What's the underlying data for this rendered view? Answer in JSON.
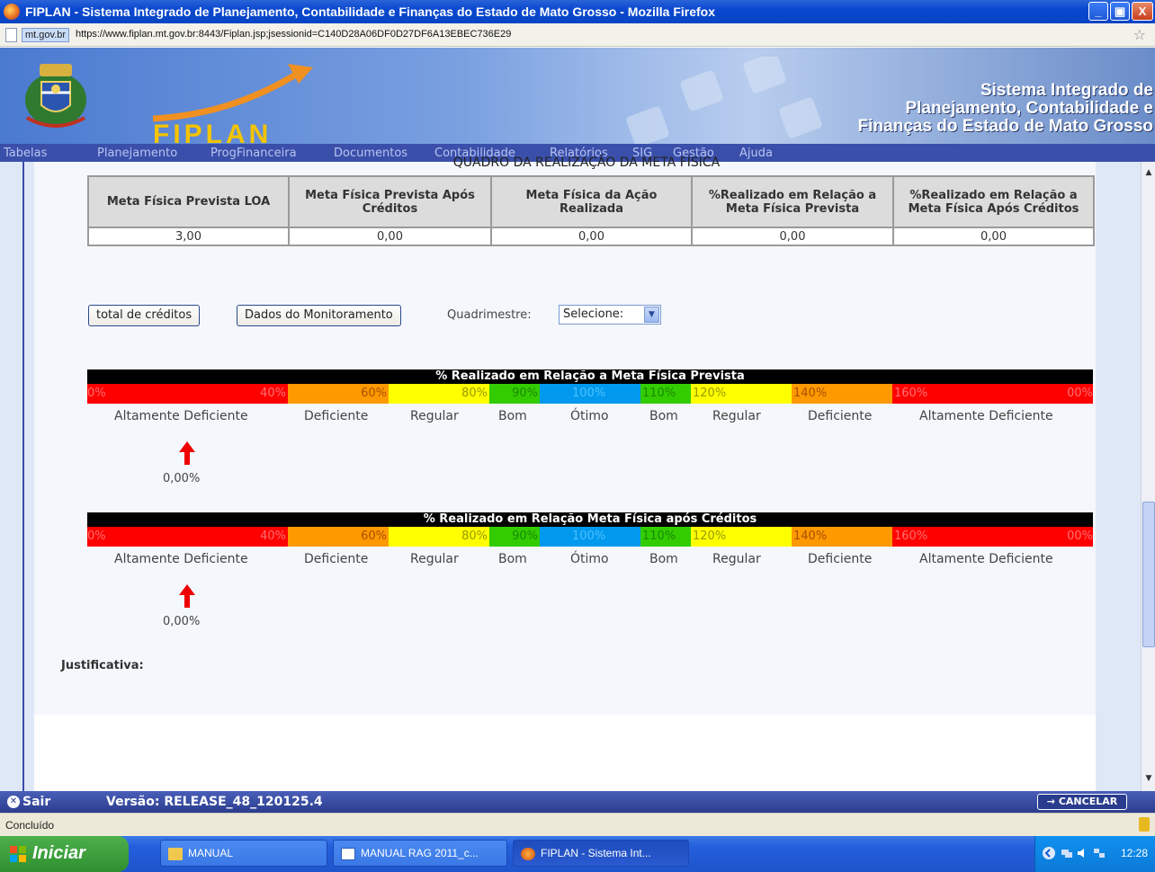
{
  "window": {
    "title": "FIPLAN - Sistema Integrado de Planejamento, Contabilidade e Finanças do Estado de Mato Grosso - Mozilla Firefox",
    "minimize": "_",
    "maximize": "▣",
    "close": "X"
  },
  "addressbar": {
    "domain": "mt.gov.br",
    "url": "https://www.fiplan.mt.gov.br:8443/Fiplan.jsp;jsessionid=C140D28A06DF0D27DF6A13EBEC736E29"
  },
  "banner": {
    "logo": "FIPLAN",
    "title_line1": "Sistema Integrado de",
    "title_line2": "Planejamento, Contabilidade e",
    "title_line3": "Finanças do Estado de Mato Grosso"
  },
  "menu": [
    "Tabelas",
    "Planejamento",
    "ProgFinanceira",
    "Documentos",
    "Contabilidade",
    "Relatórios",
    "SIG",
    "Gestão",
    "Ajuda"
  ],
  "quadro": {
    "title": "QUADRO DA REALIZAÇÃO DA META FÍSICA",
    "headers": [
      "Meta Física Prevista LOA",
      "Meta Física Prevista Após Créditos",
      "Meta Física da Ação Realizada",
      "%Realizado em Relação a Meta Física Prevista",
      "%Realizado em Relação a Meta Física Após Créditos"
    ],
    "values": [
      "3,00",
      "0,00",
      "0,00",
      "0,00",
      "0,00"
    ]
  },
  "buttons": {
    "total_creditos": "total de créditos",
    "dados_monitoramento": "Dados do Monitoramento"
  },
  "quadrimestre": {
    "label": "Quadrimestre:",
    "selected": "Selecione:"
  },
  "scale_colors": {
    "red": "#ff0000",
    "orange": "#ff9900",
    "yellow": "#ffff00",
    "green": "#33cc00",
    "blue": "#0099ee"
  },
  "scale_labels": [
    "0%",
    "40%",
    "60%",
    "80%",
    "90%",
    "100%",
    "110%",
    "120%",
    "140%",
    "160%",
    "00%"
  ],
  "scale_categories": [
    "Altamente Deficiente",
    "Deficiente",
    "Regular",
    "Bom",
    "Ótimo",
    "Bom",
    "Regular",
    "Deficiente",
    "Altamente Deficiente"
  ],
  "scale1": {
    "title": "% Realizado em Relação a Meta Física Prevista",
    "value": "0,00%"
  },
  "scale2": {
    "title": "% Realizado em Relação Meta Física após Créditos",
    "value": "0,00%"
  },
  "justificativa": "Justificativa:",
  "footer": {
    "sair": "Sair",
    "versao": "Versão: RELEASE_48_120125.4",
    "cancelar": "→ CANCELAR"
  },
  "status": "Concluído",
  "taskbar": {
    "start": "Iniciar",
    "tasks": [
      "MANUAL",
      "MANUAL RAG 2011_c...",
      "FIPLAN - Sistema Int..."
    ],
    "clock": "12:28"
  }
}
